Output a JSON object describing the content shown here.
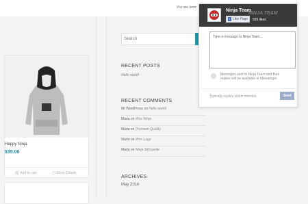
{
  "breadcrumb": {
    "label": "You are here:"
  },
  "product": {
    "name": "Happy Ninja",
    "price": "$35.00",
    "add_to_cart": "Add to cart",
    "show_details": "Show Details"
  },
  "search": {
    "placeholder": "Search"
  },
  "recent_posts": {
    "title": "RECENT POSTS",
    "items": [
      "Hello world!"
    ]
  },
  "recent_comments": {
    "title": "RECENT COMMENTS",
    "items": [
      {
        "author": "Mr WordPress",
        "post": "Hello world!"
      },
      {
        "author": "Maria",
        "post": "Woo Ninja"
      },
      {
        "author": "Maria",
        "post": "Premium Quality"
      },
      {
        "author": "Maria",
        "post": "Woo Logo"
      },
      {
        "author": "Maria",
        "post": "Ninja Silhouette"
      }
    ],
    "connector": "on"
  },
  "archives": {
    "title": "ARCHIVES",
    "items": [
      "May 2016"
    ]
  },
  "chat": {
    "page_name": "Ninja Team",
    "ghost_name": "NINJA TEAM",
    "like_label": "Like Page",
    "likes": "565 likes",
    "message_placeholder": "Type a message to Ninja Team...",
    "note": "Messages sent to Ninja Team and their replies will be available in Messenger",
    "footer": "Typically replies within minutes",
    "send_label": "Send"
  },
  "colors": {
    "accent": "#1f8ca8",
    "chat_header": "#3a3a3a",
    "send": "#9aaecb",
    "facebook": "#4267b2"
  }
}
